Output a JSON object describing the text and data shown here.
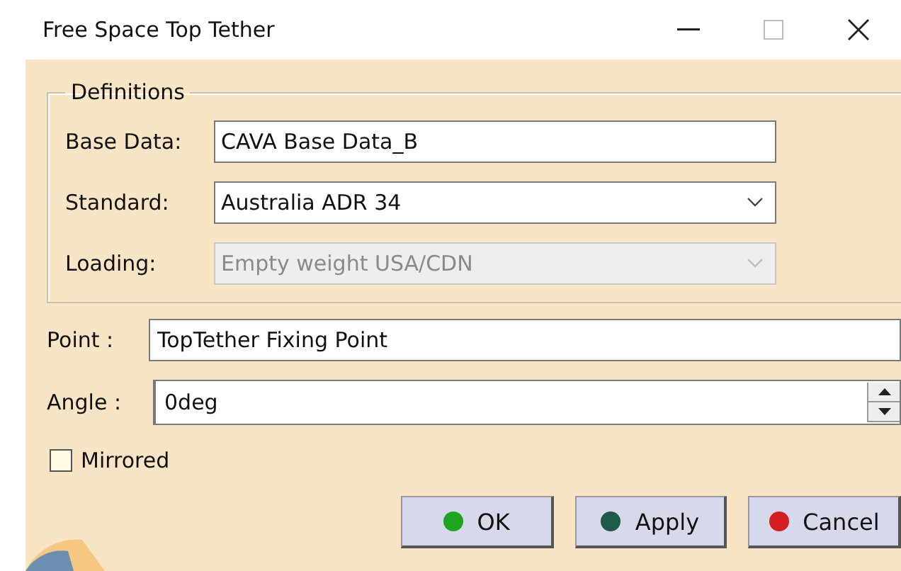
{
  "window": {
    "title": "Free Space Top Tether"
  },
  "definitions": {
    "title": "Definitions",
    "fields": [
      {
        "kind": "text",
        "label": "Base Data:",
        "value": "CAVA Base Data_B",
        "disabled": false
      },
      {
        "kind": "combo",
        "label": "Standard:",
        "value": "Australia ADR 34",
        "disabled": false
      },
      {
        "kind": "combo",
        "label": "Loading:",
        "value": "Empty weight USA/CDN",
        "disabled": true
      }
    ]
  },
  "point": {
    "label": "Point :",
    "value": "TopTether Fixing Point"
  },
  "angle": {
    "label": "Angle :",
    "value": "0deg"
  },
  "mirrored": {
    "label": "Mirrored",
    "checked": false
  },
  "buttons": [
    {
      "label": "OK",
      "color": "#1fa31f"
    },
    {
      "label": "Apply",
      "color": "#1e5a4a"
    },
    {
      "label": "Cancel",
      "color": "#d42020"
    }
  ]
}
